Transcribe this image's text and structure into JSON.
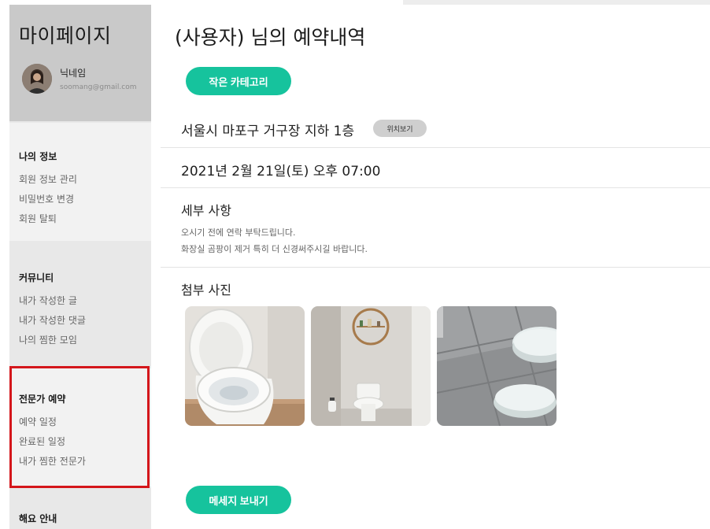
{
  "sidebar": {
    "title": "마이페이지",
    "profile": {
      "nickname": "닉네임",
      "email": "soomang@gmail.com"
    },
    "sections": [
      {
        "heading": "나의 정보",
        "items": [
          "회원 정보 관리",
          "비밀번호 변경",
          "회원 탈퇴"
        ]
      },
      {
        "heading": "커뮤니티",
        "items": [
          "내가 작성한 글",
          "내가 작성한 댓글",
          "나의 찜한 모임"
        ]
      },
      {
        "heading": "전문가 예약",
        "items": [
          "예약 일정",
          "완료된 일정",
          "내가 찜한 전문가"
        ]
      },
      {
        "heading": "해요 안내",
        "items": []
      }
    ]
  },
  "main": {
    "title": "(사용자) 님의 예약내역",
    "category_label": "작은 카테고리",
    "address": "서울시 마포구 거구장 지하 1층",
    "location_button": "위치보기",
    "datetime": "2021년 2월 21일(토) 오후 07:00",
    "details": {
      "title": "세부 사항",
      "lines": [
        "오시기 전에 연락 부탁드립니다.",
        "화장실 곰팡이 제거 특히 더 신경써주시길 바랍니다."
      ]
    },
    "photos": {
      "title": "첨부 사진"
    },
    "message_button": "메세지 보내기"
  },
  "colors": {
    "accent": "#16c39d",
    "highlight_border": "#d4161b",
    "sidebar_profile_bg": "#c9c9c9",
    "sidebar_bg": "#e8e8e8"
  }
}
